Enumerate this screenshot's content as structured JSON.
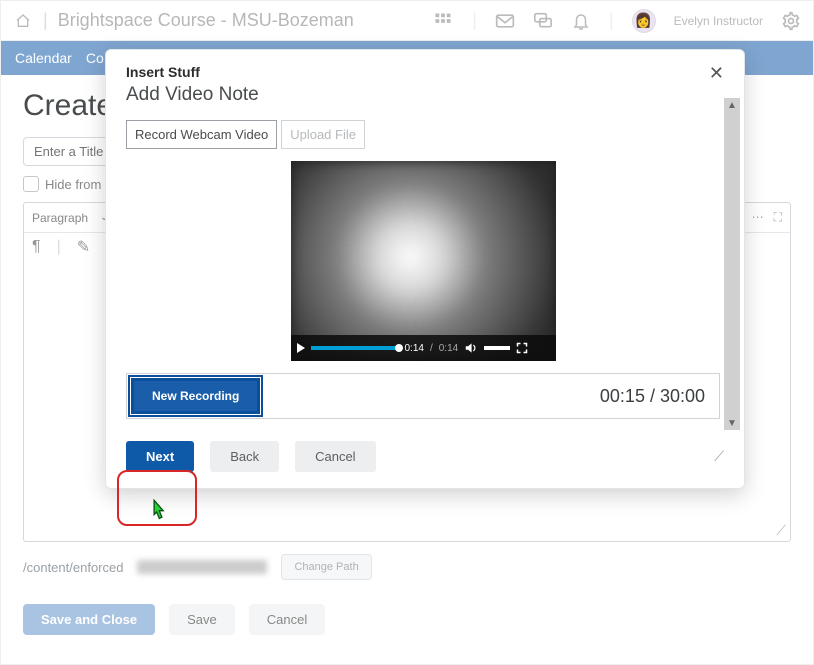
{
  "header": {
    "brand": "Brightspace Course - MSU-Bozeman",
    "user": "Evelyn Instructor"
  },
  "nav": {
    "item1": "Calendar",
    "item2": "Co"
  },
  "page": {
    "title": "Create",
    "title_placeholder": "Enter a Title",
    "hide_label": "Hide from U",
    "paragraph_label": "Paragraph",
    "path_prefix": "/content/enforced",
    "change_path": "Change Path",
    "save_close": "Save and Close",
    "save": "Save",
    "cancel": "Cancel"
  },
  "modal": {
    "title_small": "Insert Stuff",
    "title_big": "Add Video Note",
    "tab_record": "Record Webcam Video",
    "tab_upload": "Upload File",
    "video": {
      "position": "0:14",
      "duration": "0:14"
    },
    "new_recording": "New Recording",
    "rec_time": "00:15 / 30:00",
    "next": "Next",
    "back": "Back",
    "cancel": "Cancel"
  }
}
